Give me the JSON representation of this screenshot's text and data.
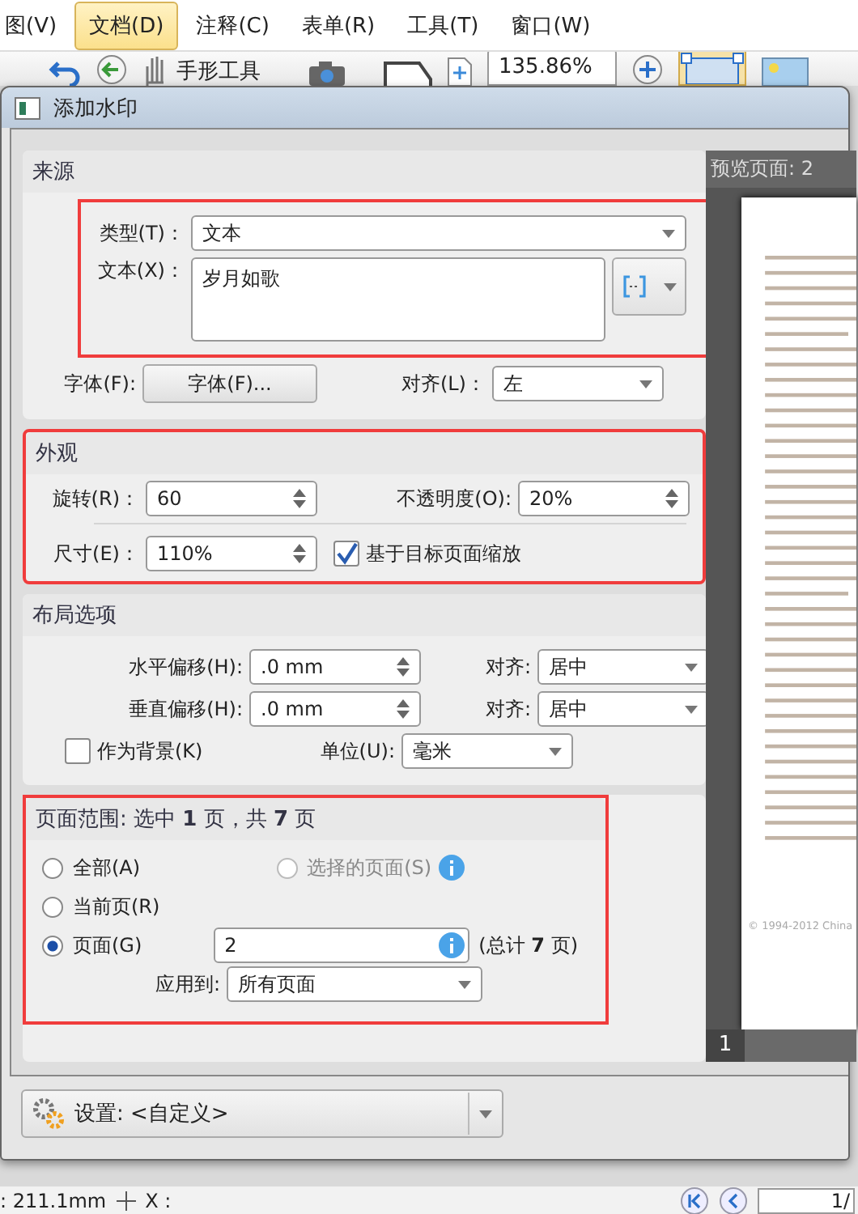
{
  "menu": [
    {
      "label": "图(V)",
      "selected": false
    },
    {
      "label": "文档(D)",
      "selected": true
    },
    {
      "label": "注释(C)",
      "selected": false
    },
    {
      "label": "表单(R)",
      "selected": false
    },
    {
      "label": "工具(T)",
      "selected": false
    },
    {
      "label": "窗口(W)",
      "selected": false
    }
  ],
  "toolbar": {
    "hand_tool": "手形工具",
    "zoom": "135.86%"
  },
  "dialog": {
    "title": "添加水印",
    "source": {
      "heading": "来源",
      "highlighted": true,
      "type_label": "类型(T)：",
      "type_value": "文本",
      "text_label": "文本(X)：",
      "text_value": "岁月如歌",
      "font_label": "字体(F):",
      "font_button": "字体(F)...",
      "align_label": "对齐(L)：",
      "align_value": "左"
    },
    "appearance": {
      "heading": "外观",
      "highlighted": true,
      "rotation_label": "旋转(R)：",
      "rotation": "60",
      "opacity_label": "不透明度(O):",
      "opacity": "20%",
      "size_label": "尺寸(E)：",
      "size": "110%",
      "scale_label": "基于目标页面缩放",
      "scale_checked": true
    },
    "layout": {
      "heading": "布局选项",
      "highlighted": false,
      "rows": [
        {
          "offset_label": "水平偏移(H):",
          "offset": ".0 mm",
          "align_label": "对齐:",
          "align": "居中"
        },
        {
          "offset_label": "垂直偏移(H):",
          "offset": ".0 mm",
          "align_label": "对齐:",
          "align": "居中"
        }
      ],
      "background_label": "作为背景(K)",
      "background_checked": false,
      "unit_label": "单位(U):",
      "unit": "毫米"
    },
    "page_range": {
      "heading": "页面范围: 选中 **1** 页，共 **7** 页",
      "highlighted": true,
      "options": [
        {
          "label": "全部(A)",
          "selected": false,
          "disabled": false
        },
        {
          "label": "选择的页面(S)",
          "selected": false,
          "disabled": true
        },
        {
          "label": "当前页(R)",
          "selected": false,
          "disabled": false
        },
        {
          "label": "页面(G)",
          "selected": true,
          "disabled": false
        }
      ],
      "pages_value": "2",
      "total": "(总计 **7** 页)",
      "apply_label": "应用到:",
      "apply_value": "所有页面"
    },
    "settings": "设置: <自定义>",
    "preview": {
      "title": "预览页面: 2",
      "copyright": "© 1994-2012 China",
      "page_number": "1"
    }
  },
  "status_bar": {
    "y": ": 211.1mm",
    "x": "X :",
    "page": "1/"
  }
}
